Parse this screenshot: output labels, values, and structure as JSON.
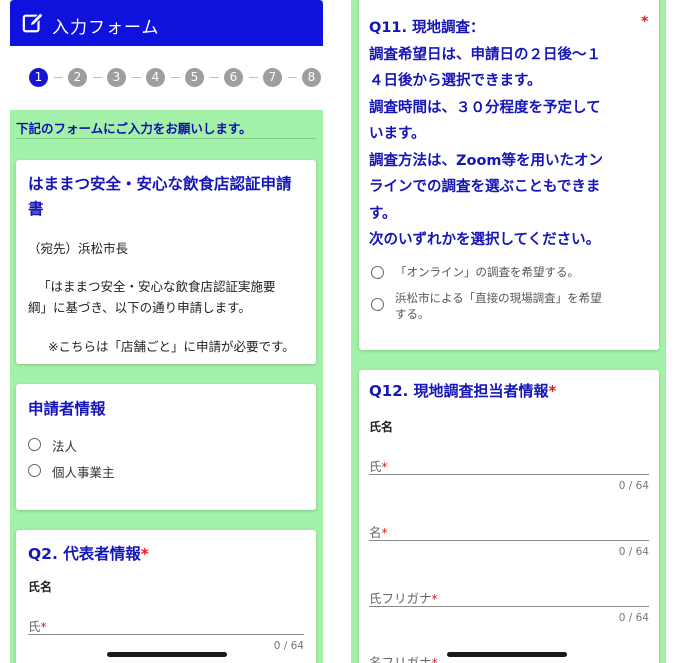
{
  "left": {
    "header": {
      "title": "入力フォーム",
      "icon": "edit-icon"
    },
    "steps": [
      "1",
      "2",
      "3",
      "4",
      "5",
      "6",
      "7",
      "8"
    ],
    "intro": "下記のフォームにご入力をお願いします。",
    "form_card": {
      "title_line1": "はままつ安全・安心な飲食店認証申請",
      "title_line2": "書",
      "addressee": "（宛先）浜松市長",
      "paragraph_line1": "「はままつ安全・安心な飲食店認証実施要",
      "paragraph_line2": "綱」に基づき、以下の通り申請します。",
      "note": "※こちらは「店舗ごと」に申請が必要です。"
    },
    "applicant_card": {
      "title": "申請者情報",
      "options": [
        "法人",
        "個人事業主"
      ]
    },
    "q2_card": {
      "title": "Q2. 代表者情報",
      "required_mark": "*",
      "sub_label": "氏名",
      "field_label": "氏",
      "required_mark_field": "*",
      "counter": "0 / 64"
    }
  },
  "right": {
    "q11_card": {
      "lines": [
        "Q11. 現地調査：",
        "調査希望日は、申請日の２日後〜１",
        "４日後から選択できます。",
        "調査時間は、３０分程度を予定して",
        "います。",
        "調査方法は、Zoom等を用いたオン",
        "ラインでの調査を選ぶこともできま",
        "す。",
        "次のいずれかを選択してください。"
      ],
      "required_mark": "*",
      "option1": "「オンライン」の調査を希望する。",
      "option2_line1": "浜松市による「直接の現場調査」を希望",
      "option2_line2": "する。"
    },
    "q12_card": {
      "title": "Q12. 現地調査担当者情報",
      "required_mark": "*",
      "sub_label": "氏名",
      "fields": [
        {
          "label": "氏",
          "required": "*",
          "counter": "0 / 64"
        },
        {
          "label": "名",
          "required": "*",
          "counter": "0 / 64"
        },
        {
          "label": "氏フリガナ",
          "required": "*",
          "counter": "0 / 64"
        },
        {
          "label": "名フリガナ",
          "required": "*"
        }
      ]
    }
  },
  "colors": {
    "header_blue": "#0f11dd",
    "title_blue": "#1515b8",
    "background_green": "#a3f0a8",
    "required_red": "#e21b1b"
  }
}
